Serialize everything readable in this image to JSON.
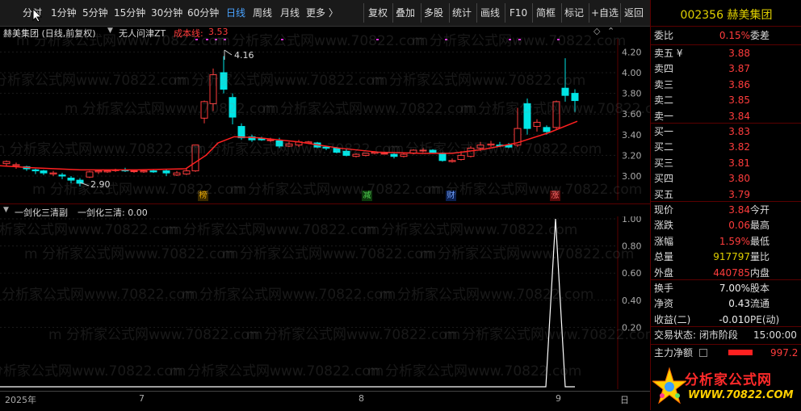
{
  "toolbar": {
    "periods": [
      "分时",
      "1分钟",
      "5分钟",
      "15分钟",
      "30分钟",
      "60分钟",
      "日线",
      "周线",
      "月线",
      "更多 〉"
    ],
    "actions": [
      "复权",
      "叠加",
      "多股",
      "统计",
      "画线",
      "F10",
      "简框",
      "标记",
      "+自选",
      "返回"
    ]
  },
  "chart_header": {
    "stock": "赫美集团 (日线,前复权)",
    "indicator": "无人问津ZT",
    "cost_label": "成本线:",
    "cost_value": "3.53"
  },
  "main_yaxis": [
    "4.20",
    "4.00",
    "3.80",
    "3.60",
    "3.40",
    "3.20",
    "3.00"
  ],
  "annotations": {
    "high": "4.16",
    "low": "2.90"
  },
  "event_marks": [
    {
      "label": "榜",
      "color": "#c89000"
    },
    {
      "label": "减",
      "color": "#2aa52a"
    },
    {
      "label": "财",
      "color": "#3a6fd0"
    },
    {
      "label": "涨",
      "color": "#c82020"
    }
  ],
  "indicator_header": {
    "name": "一剑化三清副",
    "series": "一剑化三清: 0.00"
  },
  "ind_yaxis": [
    "1.00",
    "0.80",
    "0.60",
    "0.40",
    "0.20"
  ],
  "xaxis": {
    "labels": [
      "2025年",
      "7",
      "8",
      "9"
    ],
    "corner": "日"
  },
  "quote": {
    "code": "002356",
    "name": "赫美集团",
    "weibi_label": "委比",
    "weibi": "0.15%",
    "weicha_label": "委差",
    "sells": [
      {
        "label": "卖五 ¥",
        "price": "3.88"
      },
      {
        "label": "卖四",
        "price": "3.87"
      },
      {
        "label": "卖三",
        "price": "3.86"
      },
      {
        "label": "卖二",
        "price": "3.85"
      },
      {
        "label": "卖一",
        "price": "3.84"
      }
    ],
    "buys": [
      {
        "label": "买一",
        "price": "3.83"
      },
      {
        "label": "买二",
        "price": "3.82"
      },
      {
        "label": "买三",
        "price": "3.81"
      },
      {
        "label": "买四",
        "price": "3.80"
      },
      {
        "label": "买五",
        "price": "3.79"
      }
    ],
    "stats": [
      {
        "label": "现价",
        "value": "3.84",
        "label2": "今开"
      },
      {
        "label": "涨跌",
        "value": "0.06",
        "label2": "最高"
      },
      {
        "label": "涨幅",
        "value": "1.59%",
        "label2": "最低"
      },
      {
        "label": "总量",
        "value": "917797",
        "label2": "量比"
      },
      {
        "label": "外盘",
        "value": "440785",
        "label2": "内盘"
      }
    ],
    "stats2": [
      {
        "label": "换手",
        "value": "7.00%",
        "label2": "股本"
      },
      {
        "label": "净资",
        "value": "0.43",
        "label2": "流通"
      },
      {
        "label": "收益(二)",
        "value": "-0.010",
        "label2": "PE(动)"
      }
    ],
    "status_label": "交易状态: 闭市阶段",
    "status_time": "15:00:00",
    "main_flow_label": "主力净额",
    "main_flow_value": "997.2"
  },
  "logo": {
    "title": "分析家公式网",
    "url": "WWW.70822.COM"
  },
  "watermark": "m 分析家公式网www.70822.com",
  "colors": {
    "up": "#ff3c3c",
    "down": "#00e5e5",
    "ma": "#ff2020",
    "accent": "#4aa3ff"
  }
}
